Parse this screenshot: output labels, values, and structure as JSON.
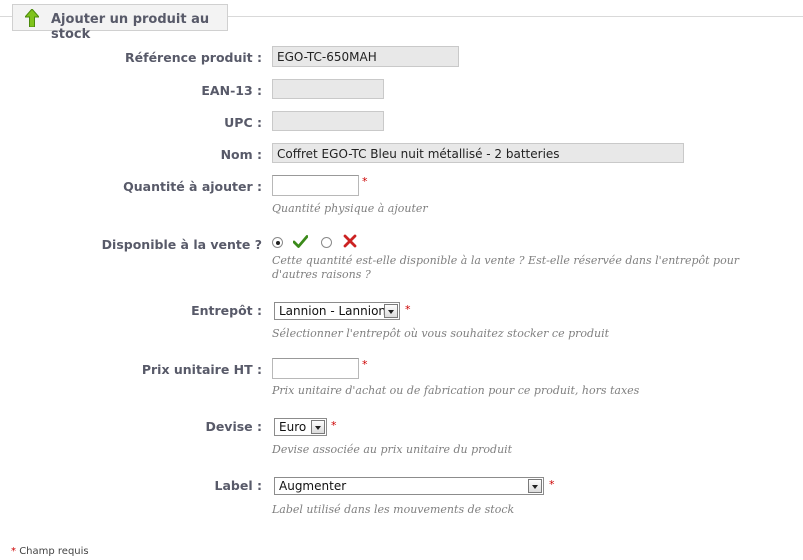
{
  "legend": {
    "title": "Ajouter un produit au stock",
    "icon": "arrow-up-icon"
  },
  "fields": {
    "reference": {
      "label": "Référence produit :",
      "value": "EGO-TC-650MAH"
    },
    "ean13": {
      "label": "EAN-13 :",
      "value": ""
    },
    "upc": {
      "label": "UPC :",
      "value": ""
    },
    "name": {
      "label": "Nom :",
      "value": "Coffret EGO-TC Bleu nuit métallisé - 2 batteries"
    },
    "quantity": {
      "label": "Quantité à ajouter :",
      "value": "",
      "required": "*",
      "hint": "Quantité physique à ajouter"
    },
    "available": {
      "label": "Disponible à la vente ?",
      "yes_icon": "check-icon",
      "no_icon": "cross-icon",
      "selected": "yes",
      "hint": "Cette quantité est-elle disponible à la vente ? Est-elle réservée dans l'entrepôt pour d'autres raisons ?"
    },
    "warehouse": {
      "label": "Entrepôt :",
      "value": "Lannion - Lannion",
      "required": "*",
      "hint": "Sélectionner l'entrepôt où vous souhaitez stocker ce produit"
    },
    "unit_price": {
      "label": "Prix unitaire HT :",
      "value": "",
      "required": "*",
      "hint": "Prix unitaire d'achat ou de fabrication pour ce produit, hors taxes"
    },
    "currency": {
      "label": "Devise :",
      "value": "Euro",
      "required": "*",
      "hint": "Devise associée au prix unitaire du produit"
    },
    "stock_label": {
      "label": "Label :",
      "value": "Augmenter",
      "required": "*",
      "hint": "Label utilisé dans les mouvements de stock"
    }
  },
  "footnote": {
    "star": "*",
    "text": "Champ requis"
  },
  "colors": {
    "required": "#cc0000",
    "check": "#3b8a1a",
    "cross": "#cc2222",
    "label": "#585a69"
  }
}
